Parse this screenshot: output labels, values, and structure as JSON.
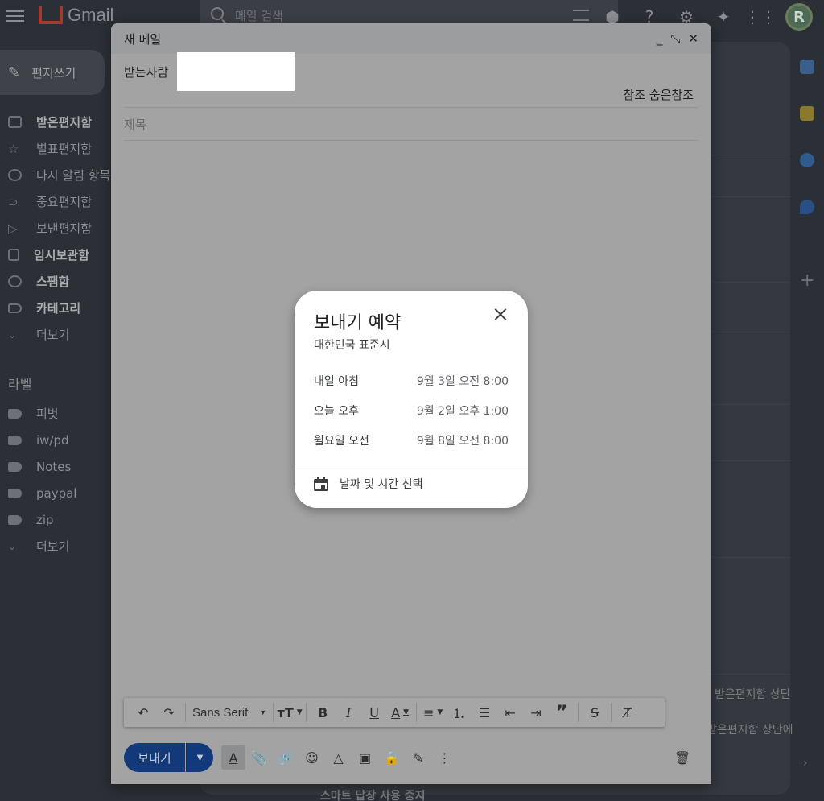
{
  "app": {
    "name": "Gmail"
  },
  "search": {
    "placeholder": "메일 검색"
  },
  "sidebar": {
    "compose_label": "편지쓰기",
    "items": [
      {
        "label": "받은편지함",
        "bold": true
      },
      {
        "label": "별표편지함",
        "bold": false
      },
      {
        "label": "다시 알림 항목",
        "bold": false
      },
      {
        "label": "중요편지함",
        "bold": false
      },
      {
        "label": "보낸편지함",
        "bold": false
      },
      {
        "label": "임시보관함",
        "bold": true
      },
      {
        "label": "스팸함",
        "bold": true
      },
      {
        "label": "카테고리",
        "bold": true
      },
      {
        "label": "더보기",
        "bold": false
      }
    ],
    "labels_title": "라벨",
    "labels": [
      {
        "label": "피벗"
      },
      {
        "label": "iw/pd"
      },
      {
        "label": "Notes"
      },
      {
        "label": "paypal"
      },
      {
        "label": "zip"
      },
      {
        "label": "더보기"
      }
    ]
  },
  "background": {
    "snippet_1": "받은편지함 상단",
    "snippet_2": "받은편지함 상단에",
    "snippet_3": "스마트 답장 사용 중지"
  },
  "compose": {
    "title": "새 메일",
    "to_label": "받는사람",
    "cc_bcc": "참조 숨은참조",
    "subject_placeholder": "제목",
    "font_name": "Sans Serif",
    "send_label": "보내기"
  },
  "schedule": {
    "title": "보내기 예약",
    "timezone": "대한민국 표준시",
    "options": [
      {
        "label": "내일 아침",
        "when": "9월 3일 오전 8:00"
      },
      {
        "label": "오늘 오후",
        "when": "9월 2일 오후 1:00"
      },
      {
        "label": "월요일 오전",
        "when": "9월 8일 오전 8:00"
      }
    ],
    "pick_label": "날짜 및 시간 선택"
  }
}
